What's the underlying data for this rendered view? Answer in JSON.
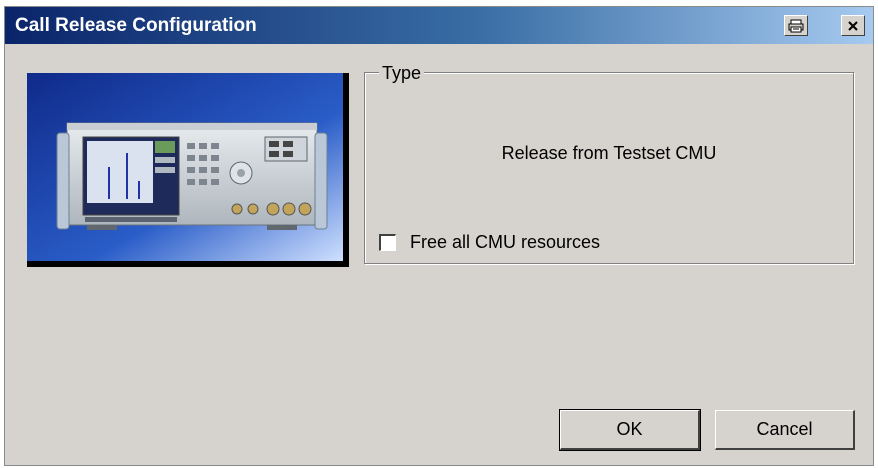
{
  "window": {
    "title": "Call Release Configuration",
    "icons": {
      "print": "printer-icon",
      "close": "close-icon"
    }
  },
  "image": {
    "description": "testset-device-photo",
    "icon": "cmu-testset-image"
  },
  "type_group": {
    "legend": "Type",
    "value": "Release from Testset CMU",
    "checkbox_label": "Free all CMU resources",
    "checkbox_checked": false
  },
  "buttons": {
    "ok": "OK",
    "cancel": "Cancel"
  },
  "colors": {
    "titlebar_start": "#0a246a",
    "titlebar_end": "#a6caf0",
    "dialog_bg": "#d6d3ce",
    "photo_bg": "#1c3fa0"
  }
}
